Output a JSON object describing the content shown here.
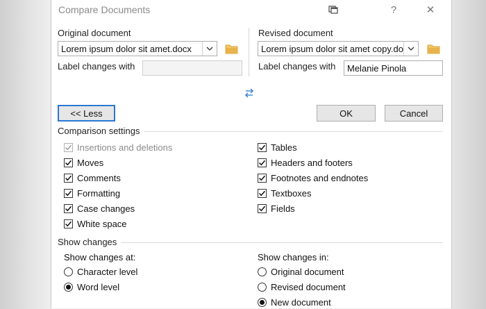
{
  "dialog": {
    "title": "Compare Documents",
    "help_label": "?",
    "close_label": "✕"
  },
  "original": {
    "label": "Original document",
    "file": "Lorem ipsum dolor sit amet.docx",
    "label_changes": "Label changes with",
    "label_value": ""
  },
  "revised": {
    "label": "Revised document",
    "file": "Lorem ipsum dolor sit amet copy.docx",
    "label_changes": "Label changes with",
    "label_value": "Melanie Pinola"
  },
  "swap_icon": "swap-arrows-icon",
  "buttons": {
    "less": "<< Less",
    "ok": "OK",
    "cancel": "Cancel"
  },
  "comparison": {
    "title": "Comparison settings",
    "left": [
      {
        "label": "Insertions and deletions",
        "checked": true,
        "disabled": true
      },
      {
        "label": "Moves",
        "checked": true,
        "disabled": false
      },
      {
        "label": "Comments",
        "checked": true,
        "disabled": false
      },
      {
        "label": "Formatting",
        "checked": true,
        "disabled": false
      },
      {
        "label": "Case changes",
        "checked": true,
        "disabled": false
      },
      {
        "label": "White space",
        "checked": true,
        "disabled": false
      }
    ],
    "right": [
      {
        "label": "Tables",
        "checked": true
      },
      {
        "label": "Headers and footers",
        "checked": true
      },
      {
        "label": "Footnotes and endnotes",
        "checked": true
      },
      {
        "label": "Textboxes",
        "checked": true
      },
      {
        "label": "Fields",
        "checked": true
      }
    ]
  },
  "show_changes": {
    "title": "Show changes",
    "at": {
      "title": "Show changes at:",
      "options": [
        {
          "label": "Character level",
          "selected": false
        },
        {
          "label": "Word level",
          "selected": true
        }
      ]
    },
    "in": {
      "title": "Show changes in:",
      "options": [
        {
          "label": "Original document",
          "selected": false
        },
        {
          "label": "Revised document",
          "selected": false
        },
        {
          "label": "New document",
          "selected": true
        }
      ]
    }
  },
  "colors": {
    "accent": "#2a78d2",
    "folder": "#e8b34a"
  }
}
